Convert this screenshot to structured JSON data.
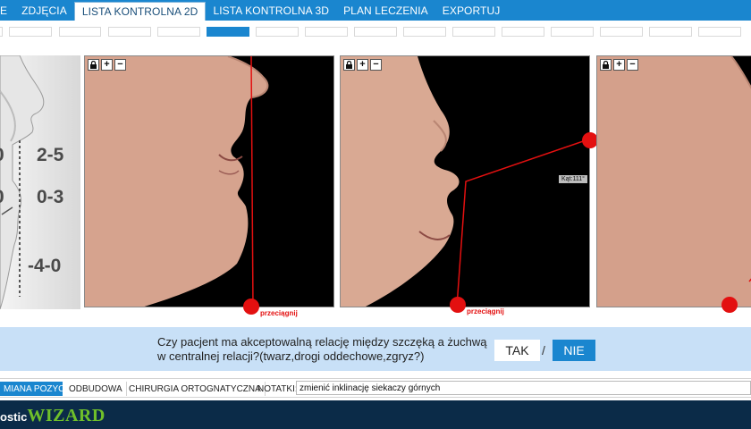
{
  "nav": {
    "tabs": [
      {
        "label": "E"
      },
      {
        "label": "ZDJĘCIA"
      },
      {
        "label": "LISTA KONTROLNA 2D"
      },
      {
        "label": "LISTA KONTROLNA 3D"
      },
      {
        "label": "PLAN LECZENIA"
      },
      {
        "label": "EXPORTUJ"
      }
    ],
    "active_tab": "LISTA KONTROLNA 2D"
  },
  "diagram": {
    "values": [
      "2-5",
      "0-3",
      "-4-0"
    ],
    "partial_left": [
      "0",
      "0"
    ]
  },
  "panels": [
    {
      "drag_label": "przeciągnij"
    },
    {
      "drag_label": "przeciągnij",
      "angle_label": "Kąt:111°"
    },
    {
      "drag_label": ""
    }
  ],
  "question": {
    "line1": "Czy pacjent ma akceptowalną relację między szczęką a żuchwą",
    "line2": "w centralnej relacji?(twarz,drogi oddechowe,zgryz?)",
    "yes": "TAK",
    "separator": "/",
    "no": "NIE"
  },
  "bottom_tabs": [
    {
      "label": "MIANA POZYCJI"
    },
    {
      "label": "ODBUDOWA"
    },
    {
      "label": "CHIRURGIA ORTOGNATYCZNA"
    },
    {
      "label": "NOTATKI:"
    }
  ],
  "notes": {
    "value": "zmienić inklinację siekaczy górnych"
  },
  "logo": {
    "part1": "ostic",
    "part2": "WIZARD"
  },
  "colors": {
    "accent": "#1a86cf",
    "footer": "#0b2b48",
    "marker": "#e31010",
    "logo_green": "#6fc02a"
  },
  "icons": [
    "lock-icon",
    "zoom-in-icon",
    "zoom-out-icon"
  ]
}
